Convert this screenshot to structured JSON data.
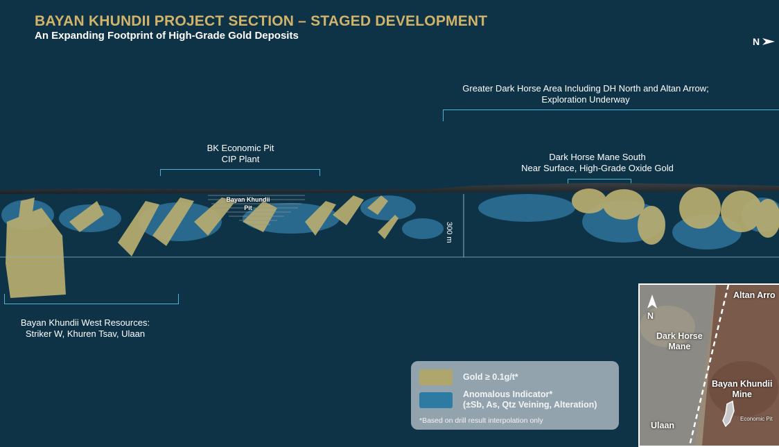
{
  "header": {
    "title": "BAYAN KHUNDII PROJECT SECTION – STAGED DEVELOPMENT",
    "subtitle": "An Expanding Footprint of High-Grade Gold Deposits"
  },
  "north_arrow": {
    "label": "N",
    "icon": "north-arrow-icon"
  },
  "annotations": {
    "greater_dark_horse": [
      "Greater Dark Horse Area Including DH North and Altan Arrow;",
      "Exploration Underway"
    ],
    "bk_pit": [
      "BK Economic Pit",
      "CIP Plant"
    ],
    "dark_horse_mane_south": [
      "Dark Horse Mane South",
      "Near Surface, High-Grade Oxide Gold"
    ],
    "bayan_khundii_pit": [
      "Bayan Khundii",
      "Pit"
    ],
    "scale_bar": "300 m",
    "bk_west": [
      "Bayan Khundii West  Resources:",
      "Striker W, Khuren Tsav, Ulaan"
    ]
  },
  "legend": {
    "items": [
      {
        "label": "Gold ≥ 0.1g/t*",
        "color": "#b8ad70"
      },
      {
        "label_lines": [
          "Anomalous Indicator*",
          "(±Sb, As, Qtz Veining, Alteration)"
        ],
        "color": "#2f7fa8"
      }
    ],
    "note": "*Based on drill result interpolation only"
  },
  "inset_map": {
    "north_label": "N",
    "labels": {
      "altan_arrow": "Altan Arro",
      "dark_horse_mane": [
        "Dark Horse",
        "Mane"
      ],
      "bayan_khundii_mine": [
        "Bayan Khundii",
        "Mine"
      ],
      "ulaan": "Ulaan",
      "economic_pit": "Economic Pit"
    }
  },
  "colors": {
    "background": "#0e3347",
    "title": "#d2b36a",
    "bracket": "#4fb3d3",
    "gold": "#b8ad70",
    "anomalous": "#2f7fa8"
  }
}
